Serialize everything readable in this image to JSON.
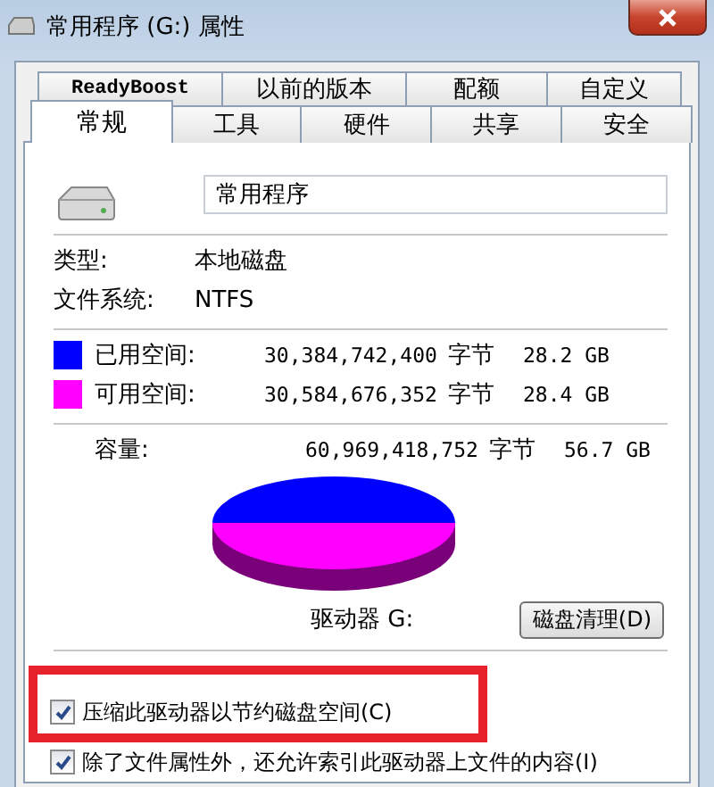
{
  "window": {
    "title": "常用程序 (G:) 属性"
  },
  "tabs_back": [
    {
      "label": "ReadyBoost",
      "selected": false
    },
    {
      "label": "以前的版本",
      "selected": false
    },
    {
      "label": "配额",
      "selected": false
    },
    {
      "label": "自定义",
      "selected": false
    }
  ],
  "tabs_front": [
    {
      "label": "常规",
      "selected": true
    },
    {
      "label": "工具",
      "selected": false
    },
    {
      "label": "硬件",
      "selected": false
    },
    {
      "label": "共享",
      "selected": false
    },
    {
      "label": "安全",
      "selected": false
    }
  ],
  "drive_name": "常用程序",
  "info": [
    {
      "label": "类型:",
      "value": "本地磁盘"
    },
    {
      "label": "文件系统:",
      "value": "NTFS"
    }
  ],
  "space": [
    {
      "label": "已用空间:",
      "bytes": "30,384,742,400",
      "unit": "字节",
      "size": "28.2 GB",
      "color": "#0000ff"
    },
    {
      "label": "可用空间:",
      "bytes": "30,584,676,352",
      "unit": "字节",
      "size": "28.4 GB",
      "color": "#ff00ff"
    }
  ],
  "capacity": {
    "label": "容量:",
    "bytes": "60,969,418,752",
    "unit": "字节",
    "size": "56.7 GB"
  },
  "drive_label": "驱动器 G:",
  "cleanup_button": "磁盘清理(D)",
  "options": [
    {
      "label": "压缩此驱动器以节约磁盘空间(C)",
      "checked": true,
      "highlighted": true
    },
    {
      "label": "除了文件属性外，还允许索引此驱动器上文件的内容(I)",
      "checked": true,
      "highlighted": false
    }
  ]
}
